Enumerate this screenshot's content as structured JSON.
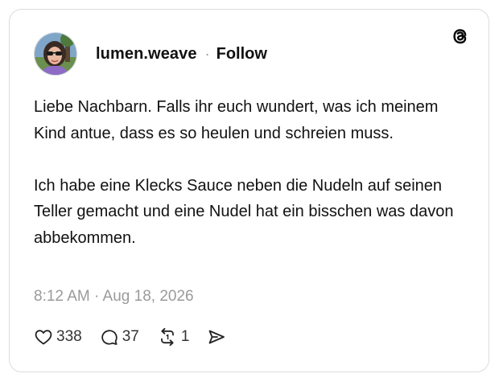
{
  "post": {
    "username": "lumen.weave",
    "separator": "·",
    "follow_label": "Follow",
    "paragraphs": [
      "Liebe Nachbarn. Falls ihr euch wundert, was ich meinem Kind antue, dass es so heulen und schreien muss.",
      "Ich habe eine Klecks Sauce neben die Nudeln auf seinen Teller gemacht und eine Nudel hat ein bisschen was davon abbekommen."
    ],
    "timestamp": "8:12 AM · Aug 18, 2026"
  },
  "actions": {
    "likes": "338",
    "replies": "37",
    "reposts": "1"
  },
  "icons": {
    "logo": "threads-logo-icon",
    "like": "heart-icon",
    "reply": "speech-bubble-icon",
    "repost": "repost-icon",
    "share": "send-icon"
  }
}
